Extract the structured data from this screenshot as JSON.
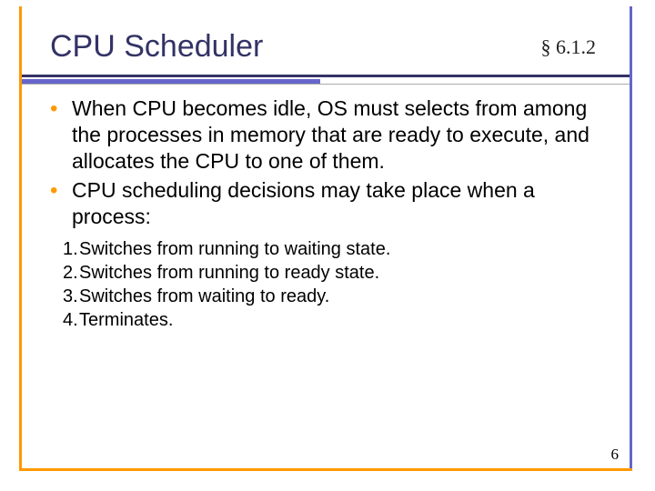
{
  "header": {
    "title": "CPU Scheduler",
    "section_ref": "§ 6.1.2"
  },
  "body": {
    "bullets": [
      "When CPU becomes idle, OS must selects from among the processes in memory that are ready to execute, and allocates the CPU to one of them.",
      "CPU scheduling decisions may take place when a process:"
    ],
    "sublist": [
      {
        "num": "1.",
        "text": "Switches from running to waiting state."
      },
      {
        "num": "2.",
        "text": "Switches from running to ready state."
      },
      {
        "num": "3.",
        "text": "Switches from waiting to ready."
      },
      {
        "num": "4.",
        "text": "Terminates."
      }
    ]
  },
  "footer": {
    "page_number": "6"
  }
}
